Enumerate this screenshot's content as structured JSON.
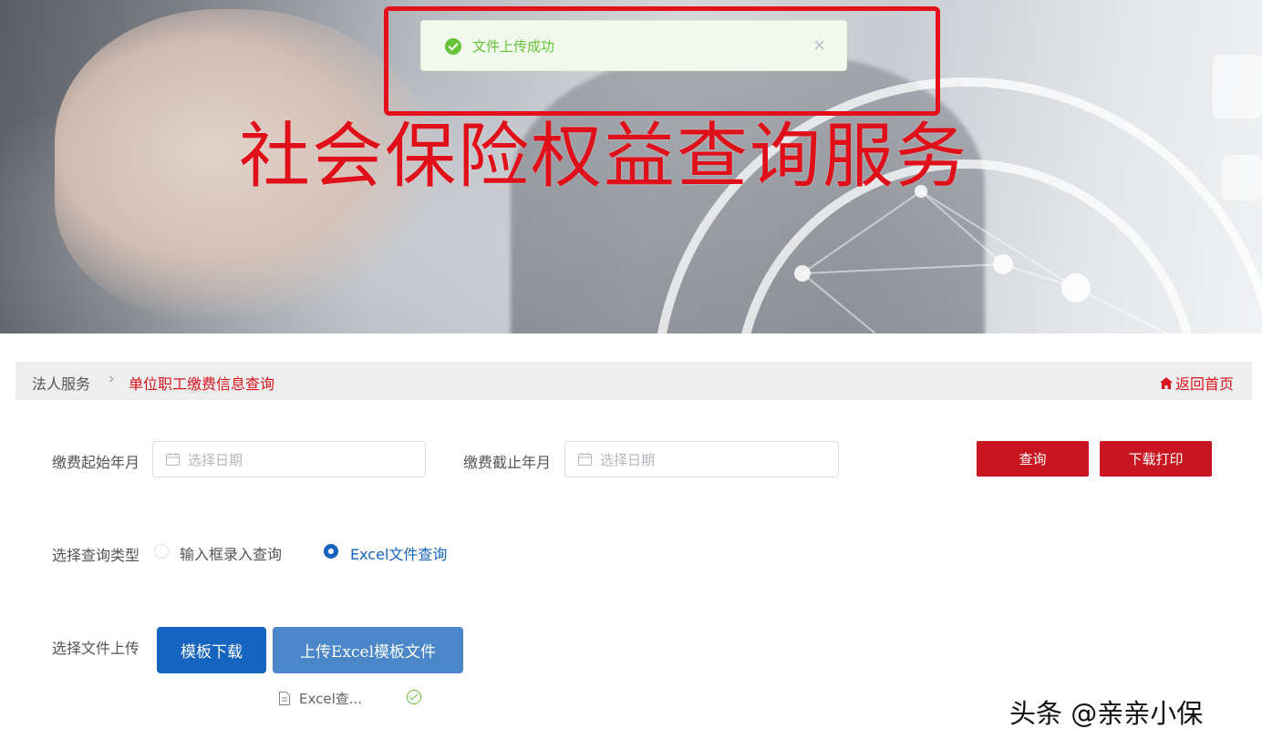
{
  "banner": {
    "title": "社会保险权益查询服务"
  },
  "toast": {
    "message": "文件上传成功",
    "close_symbol": "×"
  },
  "breadcrumb": {
    "parent": "法人服务",
    "separator": "›",
    "current": "单位职工缴费信息查询",
    "home_link": "返回首页"
  },
  "form": {
    "start_label": "缴费起始年月",
    "start_placeholder": "选择日期",
    "end_label": "缴费截止年月",
    "end_placeholder": "选择日期",
    "query_button": "查询",
    "download_print_button": "下载打印",
    "query_type_label": "选择查询类型",
    "query_type_options": [
      {
        "label": "输入框录入查询",
        "selected": false
      },
      {
        "label": "Excel文件查询",
        "selected": true
      }
    ],
    "upload_label": "选择文件上传",
    "template_download_button": "模板下载",
    "upload_button": "上传Excel模板文件",
    "uploaded_file": "Excel查..."
  },
  "watermark": "头条 @亲亲小保",
  "colors": {
    "brand_red": "#c8151f",
    "primary_blue": "#1565c0",
    "upload_blue": "#4a86c8",
    "success_green": "#67c23a"
  }
}
